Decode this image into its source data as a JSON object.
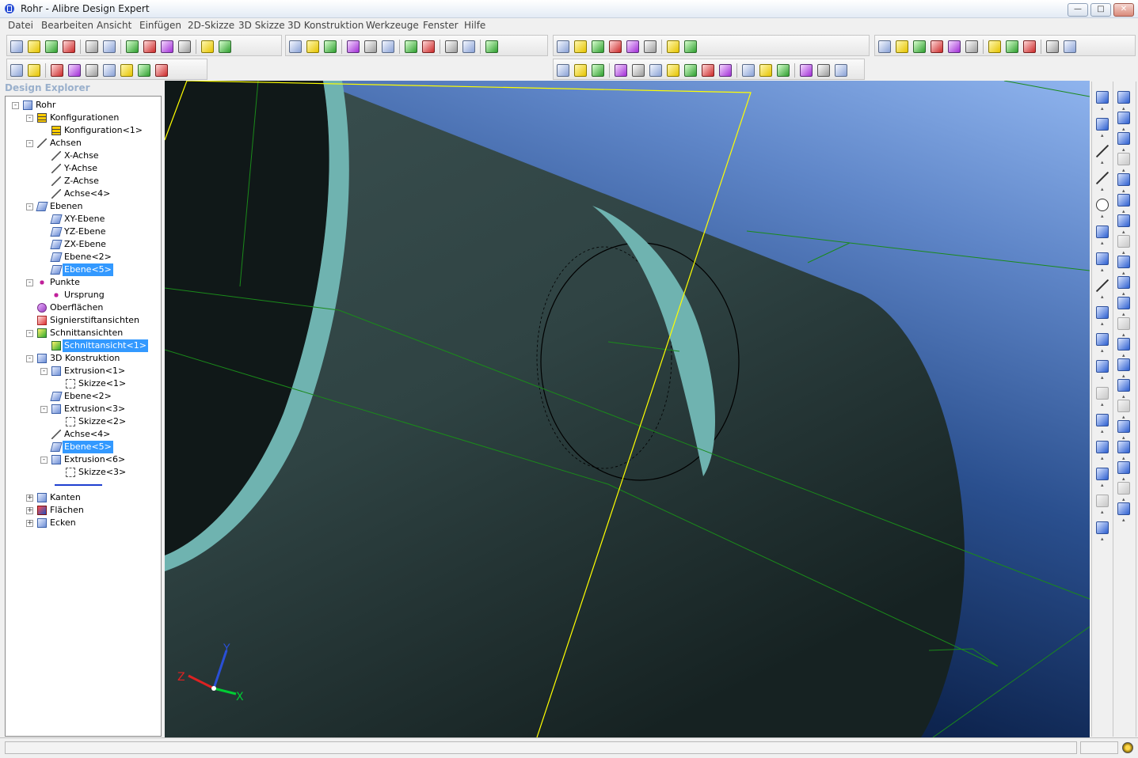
{
  "window": {
    "title": "Rohr - Alibre Design Expert",
    "buttons": [
      "minimize",
      "maximize",
      "close"
    ]
  },
  "menu": [
    {
      "id": "datei",
      "label": "Datei"
    },
    {
      "id": "bearbeiten",
      "label": "Bearbeiten"
    },
    {
      "id": "ansicht",
      "label": "Ansicht"
    },
    {
      "id": "einfuegen",
      "label": "Einfügen"
    },
    {
      "id": "2d-skizze",
      "label": "2D-Skizze"
    },
    {
      "id": "3d-skizze",
      "label": "3D Skizze"
    },
    {
      "id": "3d-konstruktion",
      "label": "3D Konstruktion"
    },
    {
      "id": "werkzeuge",
      "label": "Werkzeuge"
    },
    {
      "id": "fenster",
      "label": "Fenster"
    },
    {
      "id": "hilfe",
      "label": "Hilfe"
    }
  ],
  "design_explorer": {
    "header": "Design Explorer",
    "tree": [
      {
        "label": "Rohr",
        "level": 0,
        "toggle": "-",
        "icon": "part-icon",
        "state": ""
      },
      {
        "label": "Konfigurationen",
        "level": 1,
        "toggle": "-",
        "icon": "configurations-icon",
        "state": ""
      },
      {
        "label": "Konfiguration<1>",
        "level": 2,
        "toggle": "",
        "icon": "configuration-icon",
        "state": ""
      },
      {
        "label": "Achsen",
        "level": 1,
        "toggle": "-",
        "icon": "axes-icon",
        "state": ""
      },
      {
        "label": "X-Achse",
        "level": 2,
        "toggle": "",
        "icon": "axis-icon",
        "state": ""
      },
      {
        "label": "Y-Achse",
        "level": 2,
        "toggle": "",
        "icon": "axis-icon",
        "state": ""
      },
      {
        "label": "Z-Achse",
        "level": 2,
        "toggle": "",
        "icon": "axis-icon",
        "state": ""
      },
      {
        "label": "Achse<4>",
        "level": 2,
        "toggle": "",
        "icon": "axis-icon",
        "state": ""
      },
      {
        "label": "Ebenen",
        "level": 1,
        "toggle": "-",
        "icon": "planes-icon",
        "state": ""
      },
      {
        "label": "XY-Ebene",
        "level": 2,
        "toggle": "",
        "icon": "plane-icon",
        "state": ""
      },
      {
        "label": "YZ-Ebene",
        "level": 2,
        "toggle": "",
        "icon": "plane-icon",
        "state": ""
      },
      {
        "label": "ZX-Ebene",
        "level": 2,
        "toggle": "",
        "icon": "plane-icon",
        "state": ""
      },
      {
        "label": "Ebene<2>",
        "level": 2,
        "toggle": "",
        "icon": "plane-icon",
        "state": ""
      },
      {
        "label": "Ebene<5>",
        "level": 2,
        "toggle": "",
        "icon": "plane-icon",
        "state": "selected"
      },
      {
        "label": "Punkte",
        "level": 1,
        "toggle": "-",
        "icon": "points-icon",
        "state": ""
      },
      {
        "label": "Ursprung",
        "level": 2,
        "toggle": "",
        "icon": "origin-point-icon",
        "state": ""
      },
      {
        "label": "Oberflächen",
        "level": 1,
        "toggle": "",
        "icon": "surfaces-icon",
        "state": ""
      },
      {
        "label": "Signierstiftansichten",
        "level": 1,
        "toggle": "",
        "icon": "redline-views-icon",
        "state": ""
      },
      {
        "label": "Schnittansichten",
        "level": 1,
        "toggle": "-",
        "icon": "section-views-icon",
        "state": ""
      },
      {
        "label": "Schnittansicht<1>",
        "level": 2,
        "toggle": "",
        "icon": "section-view-icon",
        "state": "selected"
      },
      {
        "label": "3D Konstruktion",
        "level": 1,
        "toggle": "-",
        "icon": "3d-design-icon",
        "state": ""
      },
      {
        "label": "Extrusion<1>",
        "level": 2,
        "toggle": "-",
        "icon": "extrusion-icon",
        "state": ""
      },
      {
        "label": "Skizze<1>",
        "level": 3,
        "toggle": "",
        "icon": "sketch-icon",
        "state": ""
      },
      {
        "label": "Ebene<2>",
        "level": 2,
        "toggle": "",
        "icon": "plane-icon",
        "state": ""
      },
      {
        "label": "Extrusion<3>",
        "level": 2,
        "toggle": "-",
        "icon": "extrusion-icon",
        "state": ""
      },
      {
        "label": "Skizze<2>",
        "level": 3,
        "toggle": "",
        "icon": "sketch-icon",
        "state": ""
      },
      {
        "label": "Achse<4>",
        "level": 2,
        "toggle": "",
        "icon": "axis-icon",
        "state": ""
      },
      {
        "label": "Ebene<5>",
        "level": 2,
        "toggle": "",
        "icon": "plane-icon",
        "state": "selected"
      },
      {
        "label": "Extrusion<6>",
        "level": 2,
        "toggle": "-",
        "icon": "extrusion-icon",
        "state": ""
      },
      {
        "label": "Skizze<3>",
        "level": 3,
        "toggle": "",
        "icon": "sketch-icon",
        "state": ""
      },
      {
        "label": "",
        "level": 2,
        "toggle": "",
        "icon": "rollback-marker-icon",
        "state": "marker"
      },
      {
        "label": "Kanten",
        "level": 1,
        "toggle": "+",
        "icon": "edges-icon",
        "state": ""
      },
      {
        "label": "Flächen",
        "level": 1,
        "toggle": "+",
        "icon": "faces-icon",
        "state": ""
      },
      {
        "label": "Ecken",
        "level": 1,
        "toggle": "+",
        "icon": "vertices-icon",
        "state": ""
      }
    ]
  },
  "view_triad": {
    "x": "X",
    "y": "Y",
    "z": "Z"
  },
  "colors": {
    "axis_x": "#00cc33",
    "axis_y": "#2a4fd6",
    "axis_z": "#dd2222",
    "model_body": "#2e4242",
    "section_face": "#6fb3b0",
    "plane_outline": "#1a8a1a",
    "sketch_plane": "#ffff00",
    "selection": "#3399ff"
  },
  "toolbars": {
    "row1_left": [
      "new-icon",
      "open-icon",
      "save-icon",
      "save-all-icon",
      "sep",
      "print-icon",
      "print-preview-icon",
      "sep",
      "cut-icon",
      "copy-icon",
      "paste-icon",
      "delete-icon",
      "sep",
      "undo-icon",
      "redo-icon",
      "sep",
      "select-icon",
      "zoom-window-icon",
      "rotate-icon",
      "sep",
      "zoom-in-icon",
      "zoom-fit-icon",
      "zoom-out-icon",
      "sep",
      "previous-view-icon",
      "next-view-icon",
      "sep",
      "section-view-icon",
      "redline-icon",
      "sep",
      "render-icon"
    ],
    "row1_mid": [
      "reference-plane-icon",
      "reference-axis-icon",
      "reference-point-icon",
      "surface-icon",
      "configuration-icon",
      "section-box-icon",
      "sep",
      "check-icon",
      "measure-icon"
    ],
    "row1_right": [
      "view-front-icon",
      "view-back-icon",
      "view-left-icon",
      "view-right-icon",
      "view-top-icon",
      "view-bottom-icon",
      "sep",
      "view-iso-icon",
      "view-normal-icon",
      "view-custom-icon",
      "sep",
      "draw-icon",
      "properties-icon"
    ],
    "row2_left": [
      "part-color-icon",
      "feature-color-icon",
      "sep",
      "constraint-a-icon",
      "constraint-b-icon",
      "constraint-c-icon",
      "constraint-d-icon",
      "constraint-e-icon",
      "constraint-f-icon",
      "constraint-g-icon"
    ],
    "row2_right": [
      "dimension-icon",
      "shaded-icon",
      "wireframe-icon",
      "sep",
      "filter-a-icon",
      "filter-b-icon",
      "filter-c-icon",
      "filter-d-icon",
      "filter-e-icon",
      "filter-f-icon",
      "filter-g-icon",
      "sep",
      "filter-h-icon",
      "filter-i-icon",
      "filter-j-icon",
      "sep",
      "filter-k-icon",
      "filter-l-icon",
      "filter-m-icon"
    ]
  },
  "sketch_tools": [
    "activate-sketch-icon",
    "point-icon",
    "construction-line-icon",
    "line-icon",
    "circle-icon",
    "arc-icon",
    "rectangle-icon",
    "spline-icon",
    "midpoint-icon",
    "node-icon",
    "trim-icon",
    "fillet-icon",
    "pattern-icon",
    "offset-icon",
    "mirror-icon",
    "project-icon",
    "equation-icon"
  ],
  "feature_tools": [
    "extrude-boss-icon",
    "extrude-cut-icon",
    "revolve-boss-icon",
    "revolve-cut-icon",
    "loft-icon",
    "sweep-icon",
    "hole-icon",
    "thread-icon",
    "fillet-icon",
    "chamfer-icon",
    "shell-icon",
    "draft-icon",
    "mirror-feature-icon",
    "pattern-feature-icon",
    "scale-icon",
    "split-icon",
    "boolean-icon",
    "insert-part-icon",
    "equation-icon",
    "constraint-icon",
    "dimension-icon"
  ],
  "status": {
    "message": "",
    "indicator": "status-globe-icon"
  }
}
